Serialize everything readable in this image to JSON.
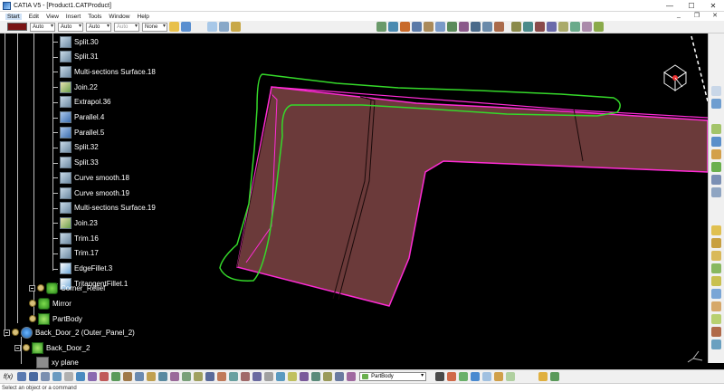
{
  "window": {
    "title": "CATIA V5 - [Product1.CATProduct]",
    "controls": [
      "—",
      "☐",
      "✕"
    ]
  },
  "menu": {
    "items": [
      "Start",
      "Edit",
      "View",
      "Insert",
      "Tools",
      "Window",
      "Help"
    ],
    "doc_controls": [
      "_",
      "❐",
      "✕"
    ]
  },
  "graphic_properties": {
    "color": "#7a1414",
    "line_type": "Auto",
    "thickness": "Auto",
    "point_symbol": "Auto",
    "rendering_style": "Auto",
    "layer": "None"
  },
  "tree": {
    "items": [
      {
        "label": "Split.30",
        "icon": "split-icon"
      },
      {
        "label": "Split.31",
        "icon": "split-icon"
      },
      {
        "label": "Multi-sections Surface.18",
        "icon": "multi-sections-surface-icon"
      },
      {
        "label": "Join.22",
        "icon": "join-icon"
      },
      {
        "label": "Extrapol.36",
        "icon": "extrapolate-icon"
      },
      {
        "label": "Parallel.4",
        "icon": "parallel-curve-icon"
      },
      {
        "label": "Parallel.5",
        "icon": "parallel-curve-icon"
      },
      {
        "label": "Split.32",
        "icon": "split-icon"
      },
      {
        "label": "Split.33",
        "icon": "split-icon"
      },
      {
        "label": "Curve smooth.18",
        "icon": "curve-smooth-icon"
      },
      {
        "label": "Curve smooth.19",
        "icon": "curve-smooth-icon"
      },
      {
        "label": "Multi-sections Surface.19",
        "icon": "multi-sections-surface-icon"
      },
      {
        "label": "Join.23",
        "icon": "join-icon"
      },
      {
        "label": "Trim.16",
        "icon": "trim-icon"
      },
      {
        "label": "Trim.17",
        "icon": "trim-icon"
      },
      {
        "label": "EdgeFillet.3",
        "icon": "edge-fillet-icon"
      },
      {
        "label": "TritangentFillet.1",
        "icon": "tritangent-fillet-icon"
      }
    ],
    "nodes": {
      "corner_relief": "Corner_Relief",
      "mirror": "Mirror",
      "partbody": "PartBody",
      "back_door_product": "Back_Door_2 (Outer_Panel_2)",
      "back_door_part": "Back_Door_2",
      "xy_plane": "xy plane"
    }
  },
  "bottom_toolbar": {
    "formula_label": "f(x)",
    "current_body": "PartBody"
  },
  "status": {
    "prompt": "Select an object or a command"
  },
  "colors": {
    "surface_fill": "#6b3a3a",
    "surface_edge": "#ff2bd6",
    "highlight_outline": "#35d92a",
    "background": "#000000"
  }
}
